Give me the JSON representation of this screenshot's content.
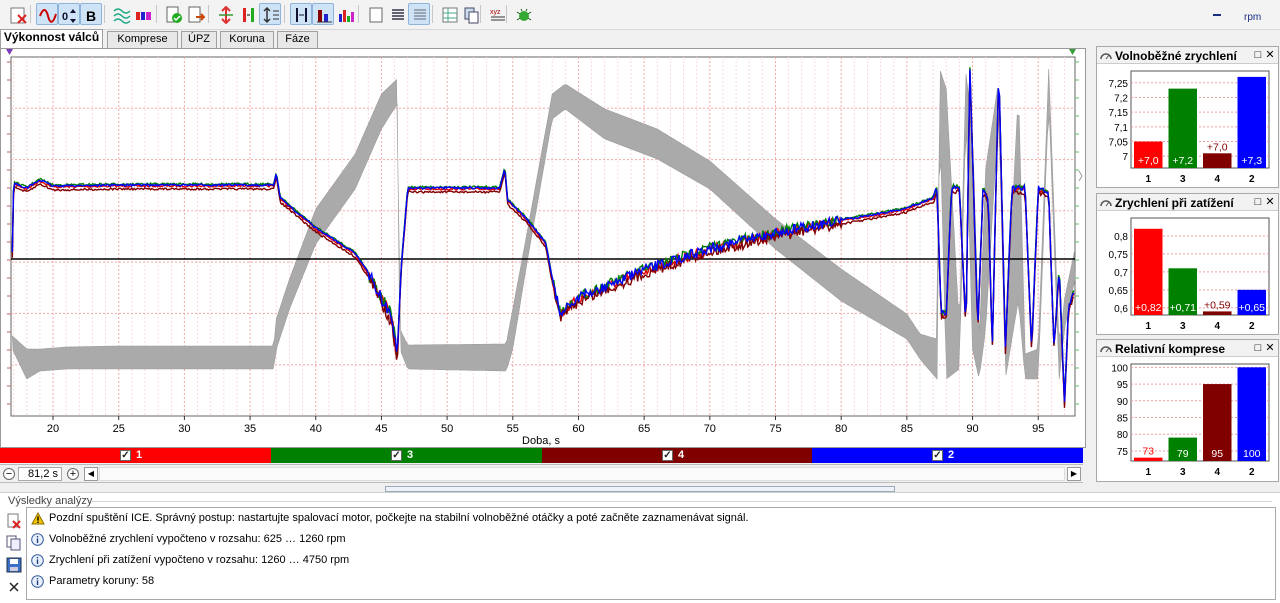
{
  "toolbar": {
    "unit": "rpm",
    "buttons": [
      "close-file-icon",
      "wave-icon",
      "scale-icon",
      "bold-icon",
      "waves-icon",
      "bars-icon",
      "doc-check-icon",
      "doc-arrow-icon",
      "vertical-cursor-icon",
      "marker-icon",
      "vertical-fit-icon",
      "cursor-icon",
      "column-icon",
      "bar-chart-icon",
      "blank-page-icon",
      "lines-icon",
      "grid-icon",
      "table-icon",
      "pages-icon",
      "report-icon",
      "bug-icon"
    ]
  },
  "tabs": [
    "Výkonnost válců",
    "Komprese",
    "ÚPZ",
    "Koruna",
    "Fáze"
  ],
  "chart_data": {
    "type": "line",
    "xlabel": "Doba, s",
    "x_ticks": [
      "20",
      "25",
      "30",
      "35",
      "40",
      "45",
      "50",
      "55",
      "60",
      "65",
      "70",
      "75",
      "80",
      "85",
      "90",
      "95"
    ],
    "xlim": [
      16.8,
      97.8
    ],
    "series": [
      {
        "name": "1",
        "color": "#e00000"
      },
      {
        "name": "3",
        "color": "#008000"
      },
      {
        "name": "4",
        "color": "#800000"
      },
      {
        "name": "2",
        "color": "#0000ff"
      },
      {
        "name": "rpm",
        "color": "#aaaaaa"
      }
    ],
    "grid": true
  },
  "channels": [
    {
      "label": "1",
      "color": "#ff0000",
      "checked": "✓"
    },
    {
      "label": "3",
      "color": "#008000",
      "checked": "✓"
    },
    {
      "label": "4",
      "color": "#800000",
      "checked": "✓"
    },
    {
      "label": "2",
      "color": "#0000ff",
      "checked": "✓"
    }
  ],
  "time_value": "81,2 s",
  "results": {
    "title": "Výsledky analýzy",
    "messages": [
      {
        "icon": "warning",
        "text": "Pozdní spuštění ICE. Správný postup: nastartujte spalovací motor, počkejte na stabilní volnoběžné otáčky a poté začněte zaznamenávat signál."
      },
      {
        "icon": "info",
        "text": "Volnoběžné zrychlení vypočteno v rozsahu: 625 … 1260 rpm"
      },
      {
        "icon": "info",
        "text": "Zrychlení při zatížení vypočteno v rozsahu: 1260 … 4750 rpm"
      },
      {
        "icon": "info",
        "text": "Parametry koruny: 58"
      }
    ]
  },
  "panels": [
    {
      "title": "Volnoběžné zrychlení",
      "chart_data": {
        "type": "bar",
        "categories": [
          "1",
          "3",
          "4",
          "2"
        ],
        "values": [
          7.05,
          7.23,
          7.01,
          7.27
        ],
        "labels": [
          "+7,0",
          "+7,2",
          "+7,0",
          "+7,3"
        ],
        "colors": [
          "#ff0000",
          "#008000",
          "#800000",
          "#0000ff"
        ],
        "ylim": [
          6.96,
          7.29
        ],
        "y_ticks": [
          {
            "v": 7.25,
            "l": "7,25"
          },
          {
            "v": 7.2,
            "l": "7,2"
          },
          {
            "v": 7.15,
            "l": "7,15"
          },
          {
            "v": 7.1,
            "l": "7,1"
          },
          {
            "v": 7.05,
            "l": "7,05"
          },
          {
            "v": 7.0,
            "l": "7"
          }
        ]
      }
    },
    {
      "title": "Zrychlení při zatížení",
      "chart_data": {
        "type": "bar",
        "categories": [
          "1",
          "3",
          "4",
          "2"
        ],
        "values": [
          0.82,
          0.71,
          0.59,
          0.65
        ],
        "labels": [
          "+0,82",
          "+0,71",
          "+0,59",
          "+0,65"
        ],
        "colors": [
          "#ff0000",
          "#008000",
          "#800000",
          "#0000ff"
        ],
        "ylim": [
          0.58,
          0.85
        ],
        "y_ticks": [
          {
            "v": 0.8,
            "l": "0,8"
          },
          {
            "v": 0.75,
            "l": "0,75"
          },
          {
            "v": 0.7,
            "l": "0,7"
          },
          {
            "v": 0.65,
            "l": "0,65"
          },
          {
            "v": 0.6,
            "l": "0,6"
          }
        ]
      }
    },
    {
      "title": "Relativní komprese",
      "chart_data": {
        "type": "bar",
        "categories": [
          "1",
          "3",
          "4",
          "2"
        ],
        "values": [
          73,
          79,
          95,
          100
        ],
        "labels": [
          "73",
          "79",
          "95",
          "100"
        ],
        "colors": [
          "#ff0000",
          "#008000",
          "#800000",
          "#0000ff"
        ],
        "ylim": [
          72,
          101
        ],
        "y_ticks": [
          {
            "v": 100,
            "l": "100"
          },
          {
            "v": 95,
            "l": "95"
          },
          {
            "v": 90,
            "l": "90"
          },
          {
            "v": 85,
            "l": "85"
          },
          {
            "v": 80,
            "l": "80"
          },
          {
            "v": 75,
            "l": "75"
          }
        ]
      }
    }
  ]
}
